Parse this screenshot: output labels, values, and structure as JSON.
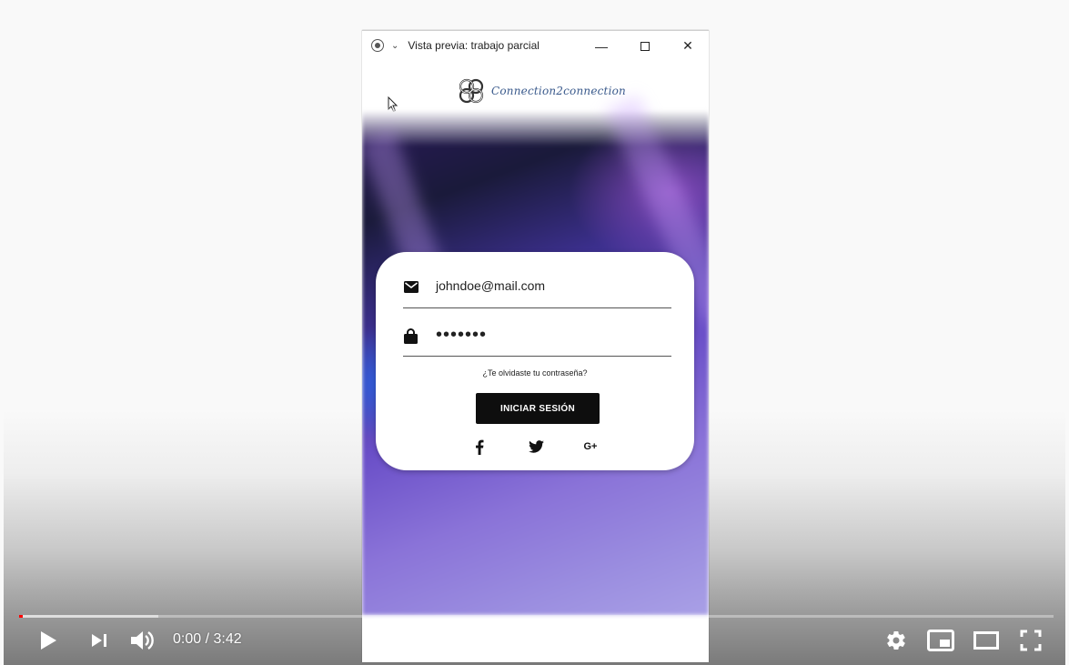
{
  "window": {
    "title": "Vista previa: trabajo parcial",
    "minimize_label": "—",
    "close_label": "✕"
  },
  "app": {
    "brand": "Connection2connection"
  },
  "login": {
    "email_value": "johndoe@mail.com",
    "password_value": "•••••••",
    "forgot_label": "¿Te olvidaste tu contraseña?",
    "submit_label": "INICIAR SESIÓN",
    "social": [
      "facebook-icon",
      "twitter-icon",
      "google-plus-icon"
    ],
    "google_label": "G+"
  },
  "player": {
    "time": "0:00 / 3:42",
    "progress_fraction": 0.0,
    "buffered_fraction": 0.135,
    "accent": "#ff0000",
    "icons": [
      "play-icon",
      "next-icon",
      "volume-icon",
      "settings-icon",
      "miniplayer-icon",
      "theater-icon",
      "fullscreen-icon"
    ]
  }
}
